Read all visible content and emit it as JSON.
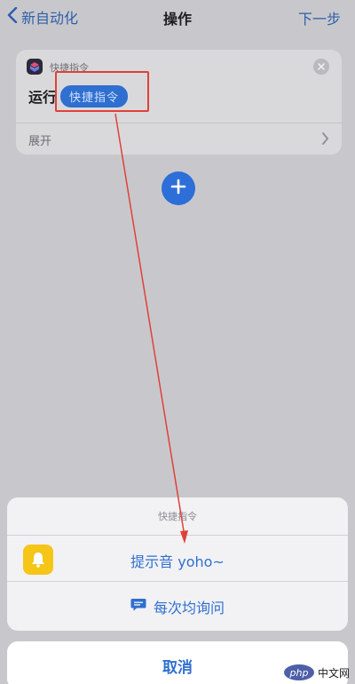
{
  "navbar": {
    "back_label": "新自动化",
    "title": "操作",
    "next_label": "下一步"
  },
  "action_card": {
    "app_name": "快捷指令",
    "run_label": "运行",
    "shortcut_placeholder": "快捷指令",
    "expand_label": "展开"
  },
  "sheet": {
    "header": "快捷指令",
    "option_yoho": "提示音 yoho~",
    "option_ask": "每次均询问",
    "cancel_label": "取消"
  },
  "watermark": {
    "badge": "php",
    "text": "中文网"
  },
  "colors": {
    "accent": "#2f6fcf",
    "annotation": "#e0403a",
    "bell_bg": "#f5c518"
  }
}
